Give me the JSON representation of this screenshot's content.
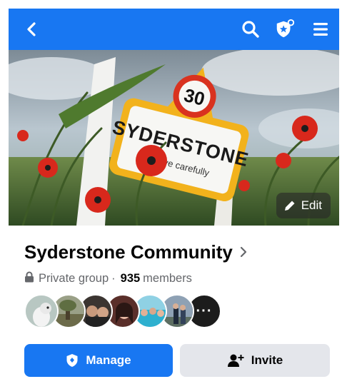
{
  "colors": {
    "topbar": "#1877f2",
    "primary_button": "#1877f2",
    "secondary_button": "#e4e6eb",
    "text_primary": "#050505",
    "text_secondary": "#65676b"
  },
  "topbar": {
    "icons": [
      "back-arrow-icon",
      "search-icon",
      "shield-star-icon",
      "menu-icon"
    ]
  },
  "cover": {
    "sign_speed": "30",
    "sign_name": "SYDERSTONE",
    "sign_subtext": "se drive carefully",
    "edit_label": "Edit"
  },
  "group": {
    "name": "Syderstone Community",
    "privacy": "Private group",
    "separator": "·",
    "member_count": "935",
    "member_label": "members"
  },
  "members_preview": {
    "count_shown": 7,
    "more_label": "···"
  },
  "actions": {
    "manage_label": "Manage",
    "invite_label": "Invite"
  }
}
